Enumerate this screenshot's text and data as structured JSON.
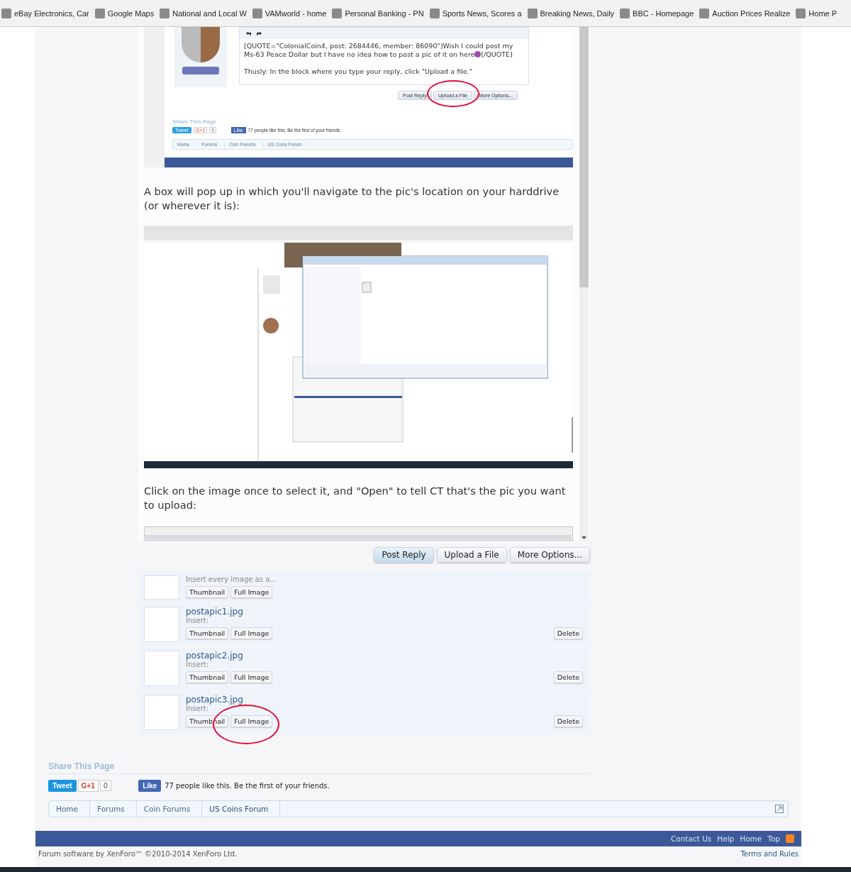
{
  "bookmarks": [
    {
      "label": "eBay  Electronics, Car"
    },
    {
      "label": "Google Maps"
    },
    {
      "label": "National and Local W"
    },
    {
      "label": "VAMworld - home"
    },
    {
      "label": "Personal Banking - PN"
    },
    {
      "label": "Sports News, Scores a"
    },
    {
      "label": "Breaking News, Daily"
    },
    {
      "label": "BBC - Homepage"
    },
    {
      "label": "Auction Prices Realize"
    },
    {
      "label": "Home P"
    }
  ],
  "post": {
    "embedded_reply": {
      "quote": "[QUOTE=\"ColonialCoin4, post: 2684446, member: 86090\"]Wish I could post my Ms-63 Peace Dollar but I have no idea how to post a pic of it on here",
      "quote_end": "[/QUOTE]",
      "reply": "Thusly: In the block where you type your reply, click \"Upload a file.\"",
      "buttons": [
        "Post Reply",
        "Upload a File",
        "More Options..."
      ],
      "share_title": "Share This Page",
      "tweet": "Tweet",
      "gplus": "G+1",
      "gplus_count": "0",
      "like": "Like",
      "like_text": "77 people like this. Be the first of your friends.",
      "breadcrumbs": [
        "Home",
        "Forums",
        "Coin Forums",
        "US Coins Forum"
      ]
    },
    "paragraphs": [
      "A box will pop up in which you'll navigate to the pic's location on your harddrive (or wherever it is):",
      "Click on the image once to select it, and \"Open\" to tell CT that's the pic you want to upload:"
    ]
  },
  "buttons": [
    "Post Reply",
    "Upload a File",
    "More Options..."
  ],
  "attachments": {
    "insert_all": {
      "label": "Insert every image as a...",
      "buttons": [
        "Thumbnail",
        "Full Image"
      ]
    },
    "files": [
      {
        "name": "postapic1.jpg",
        "insert_label": "Insert:",
        "buttons": [
          "Thumbnail",
          "Full Image"
        ],
        "delete": "Delete"
      },
      {
        "name": "postapic2.jpg",
        "insert_label": "Insert:",
        "buttons": [
          "Thumbnail",
          "Full Image"
        ],
        "delete": "Delete"
      },
      {
        "name": "postapic3.jpg",
        "insert_label": "Insert:",
        "buttons": [
          "Thumbnail",
          "Full Image"
        ],
        "delete": "Delete"
      }
    ]
  },
  "share": {
    "title": "Share This Page",
    "tweet": "Tweet",
    "gplus": "G+1",
    "gplus_count": "0",
    "like": "Like",
    "like_text": "77 people like this. Be the first of your friends."
  },
  "breadcrumbs": [
    "Home",
    "Forums",
    "Coin Forums",
    "US Coins Forum"
  ],
  "footer": {
    "links": [
      "Contact Us",
      "Help",
      "Home",
      "Top"
    ],
    "copyright": "Forum software by XenForo™ ©2010-2014 XenForo Ltd.",
    "terms": "Terms and Rules"
  }
}
